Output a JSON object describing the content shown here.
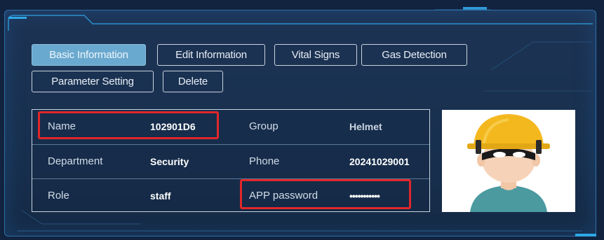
{
  "tabs": [
    {
      "label": "Basic Information",
      "active": true
    },
    {
      "label": "Edit Information",
      "active": false
    },
    {
      "label": "Vital Signs",
      "active": false
    },
    {
      "label": "Gas Detection",
      "active": false
    },
    {
      "label": "Parameter Setting",
      "active": false
    },
    {
      "label": "Delete",
      "active": false
    }
  ],
  "info": {
    "rows": [
      {
        "label1": "Name",
        "value1": "102901D6",
        "label2": "Group",
        "value2": "Helmet"
      },
      {
        "label1": "Department",
        "value1": "Security",
        "label2": "Phone",
        "value2": "20241029001"
      },
      {
        "label1": "Role",
        "value1": "staff",
        "label2": "APP password",
        "value2": "•••••••••••"
      }
    ]
  },
  "avatar": {
    "icon": "helmet-worker-avatar"
  },
  "colors": {
    "accent": "#6aa9cf",
    "highlight": "#e0272a",
    "panel": "#1d3354"
  }
}
